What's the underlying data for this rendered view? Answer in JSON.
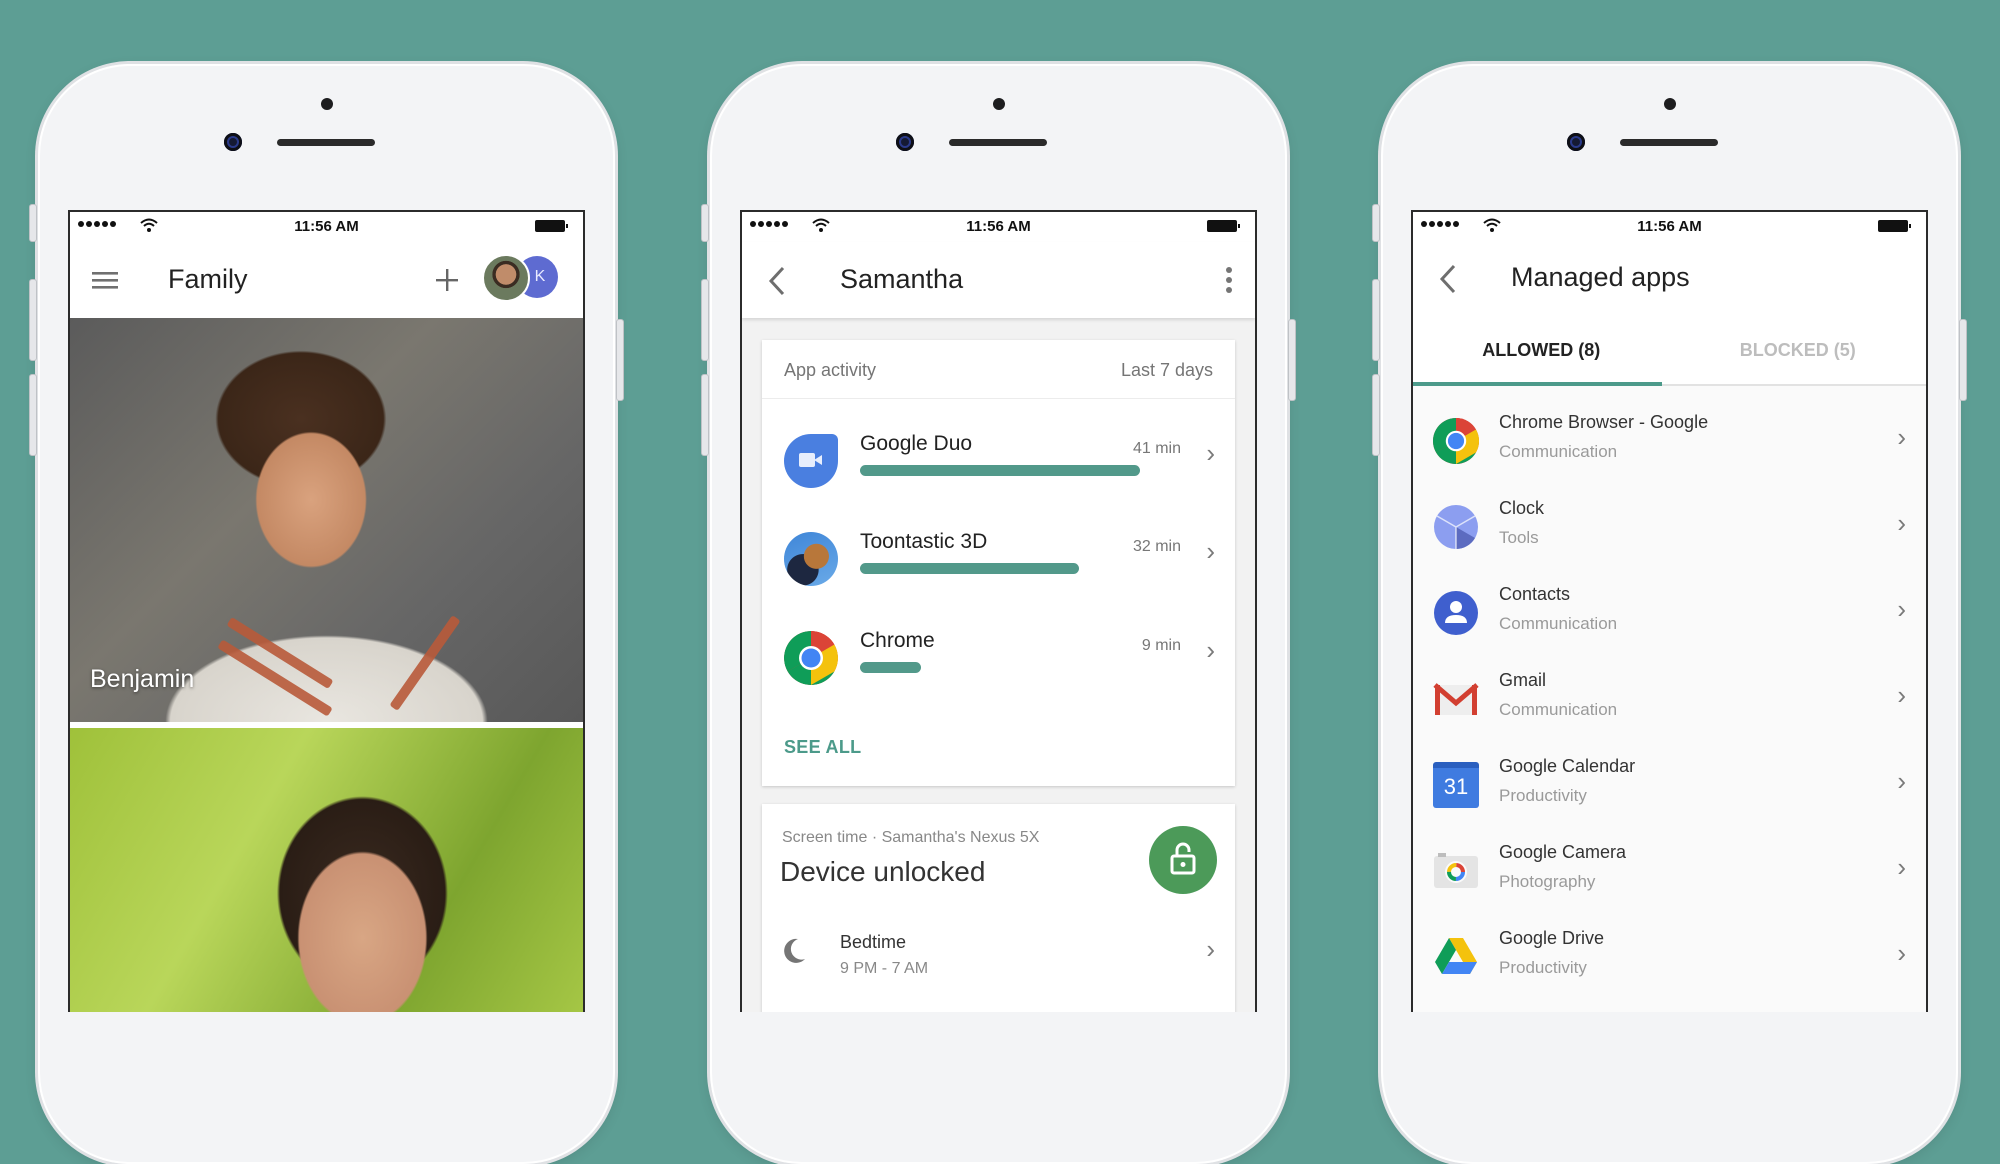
{
  "background_color": "#5d9e94",
  "accent_color": "#4c9a8a",
  "status_bar": {
    "signal": "signal-dots",
    "wifi": "wifi-icon",
    "time": "11:56 AM",
    "battery": "battery-icon"
  },
  "phone_family": {
    "title": "Family",
    "menu_icon": "hamburger-menu-icon",
    "add_icon": "plus-icon",
    "account_avatar_initial": "K",
    "members": [
      {
        "name": "Benjamin"
      },
      {
        "name": ""
      }
    ]
  },
  "phone_child": {
    "title": "Samantha",
    "back_icon": "back-chevron-icon",
    "more_icon": "more-vert-icon",
    "activity_card": {
      "label": "App activity",
      "period": "Last 7 days",
      "apps": [
        {
          "name": "Google Duo",
          "time": "41 min",
          "minutes": 41,
          "icon": "google-duo-icon"
        },
        {
          "name": "Toontastic 3D",
          "time": "32 min",
          "minutes": 32,
          "icon": "toontastic-icon"
        },
        {
          "name": "Chrome",
          "time": "9 min",
          "minutes": 9,
          "icon": "chrome-icon"
        }
      ],
      "see_all": "SEE ALL"
    },
    "screen_time_card": {
      "label": "Screen time · Samantha's Nexus 5X",
      "status": "Device unlocked",
      "lock_icon": "unlocked-padlock-icon",
      "bedtime": {
        "label": "Bedtime",
        "range": "9 PM - 7 AM",
        "icon": "moon-icon"
      }
    }
  },
  "phone_apps": {
    "title": "Managed apps",
    "tabs": [
      {
        "label": "ALLOWED (8)",
        "active": true
      },
      {
        "label": "BLOCKED (5)",
        "active": false
      }
    ],
    "apps": [
      {
        "name": "Chrome Browser - Google",
        "category": "Communication",
        "icon": "chrome-icon"
      },
      {
        "name": "Clock",
        "category": "Tools",
        "icon": "clock-icon"
      },
      {
        "name": "Contacts",
        "category": "Communication",
        "icon": "contacts-icon"
      },
      {
        "name": "Gmail",
        "category": "Communication",
        "icon": "gmail-icon"
      },
      {
        "name": "Google Calendar",
        "category": "Productivity",
        "icon": "calendar-icon",
        "icon_text": "31"
      },
      {
        "name": "Google Camera",
        "category": "Photography",
        "icon": "camera-icon"
      },
      {
        "name": "Google Drive",
        "category": "Productivity",
        "icon": "drive-icon"
      }
    ]
  }
}
